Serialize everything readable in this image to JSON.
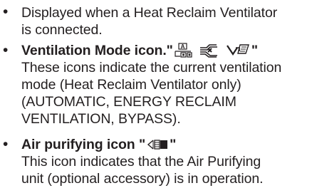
{
  "items": [
    {
      "bullet": "•",
      "lines": [
        "Displayed when a Heat Reclaim Ventilator",
        "is connected."
      ]
    },
    {
      "bullet": "•",
      "heading": {
        "label": "Ventilation Mode icon.",
        "quote_open": "\"",
        "quote_close": "\"",
        "icons": [
          "automatic-ventilation-icon",
          "energy-reclaim-ventilation-icon",
          "bypass-ventilation-icon"
        ],
        "icon_badge_text": "A"
      },
      "lines": [
        "These icons indicate the current ventilation",
        "mode (Heat Reclaim Ventilator only)",
        "(AUTOMATIC, ENERGY RECLAIM",
        "VENTILATION, BYPASS)."
      ]
    },
    {
      "bullet": "•",
      "heading": {
        "label": "Air purifying icon ",
        "quote_open": "\"",
        "quote_close": "\"",
        "icons": [
          "air-purifying-icon"
        ]
      },
      "lines": [
        "This icon indicates that the Air Purifying",
        "unit (optional accessory) is in operation."
      ]
    }
  ]
}
